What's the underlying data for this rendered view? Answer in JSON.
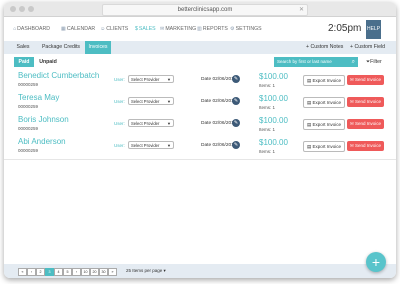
{
  "browser": {
    "url": "betterclinicsapp.com"
  },
  "nav": {
    "items": [
      {
        "icon": "dashboard-icon",
        "glyph": "⌂",
        "label": "DASHBOARD"
      },
      {
        "icon": "calendar-icon",
        "glyph": "▦",
        "label": "CALENDAR"
      },
      {
        "icon": "clients-icon",
        "glyph": "☺",
        "label": "CLIENTS"
      },
      {
        "icon": "sales-icon",
        "glyph": "$",
        "label": "SALES"
      },
      {
        "icon": "marketing-icon",
        "glyph": "✉",
        "label": "MARKETING"
      },
      {
        "icon": "reports-icon",
        "glyph": "▥",
        "label": "REPORTS"
      },
      {
        "icon": "settings-icon",
        "glyph": "⚙",
        "label": "SETTINGS"
      }
    ],
    "time": "2:05pm",
    "help": "HELP"
  },
  "tabs": [
    {
      "label": "Sales"
    },
    {
      "label": "Package Credits"
    },
    {
      "label": "Invoices",
      "active": true
    }
  ],
  "header_buttons": {
    "custom_notes": "+ Custom Notes",
    "custom_field": "+ Custom Field"
  },
  "filters": {
    "paid": "Paid",
    "unpaid": "Unpaid",
    "search_placeholder": "Search by first or last name",
    "filter_label": "Filter"
  },
  "row_labels": {
    "user": "User:",
    "date": "Date",
    "items": "Items:",
    "export": "Export Invoice",
    "send": "Send Invoice"
  },
  "invoices": [
    {
      "name": "Benedict Cumberbatch",
      "id": "00000259",
      "provider": "Select Provider",
      "date": "02/06/2018",
      "amount": "$100.00",
      "items": "1"
    },
    {
      "name": "Teresa May",
      "id": "00000259",
      "provider": "Select Provider",
      "date": "02/06/2018",
      "amount": "$100.00",
      "items": "1"
    },
    {
      "name": "Boris Johnson",
      "id": "00000259",
      "provider": "Select Provider",
      "date": "02/06/2018",
      "amount": "$100.00",
      "items": "1"
    },
    {
      "name": "Abi Anderson",
      "id": "00000259",
      "provider": "Select Provider",
      "date": "02/06/2018",
      "amount": "$100.00",
      "items": "1"
    }
  ],
  "pagination": {
    "pages": [
      "«",
      "‹",
      "2",
      "3",
      "4",
      "5",
      "›",
      "10",
      "20",
      "30",
      "»"
    ],
    "current": "3",
    "per_page": "25 Items per page",
    "per_page_caret": "▾"
  },
  "fab": "+",
  "colors": {
    "accent": "#4dbdc3",
    "danger": "#ef5a5a",
    "help": "#4a6f8c",
    "tabsbar": "#e4ebf2"
  }
}
